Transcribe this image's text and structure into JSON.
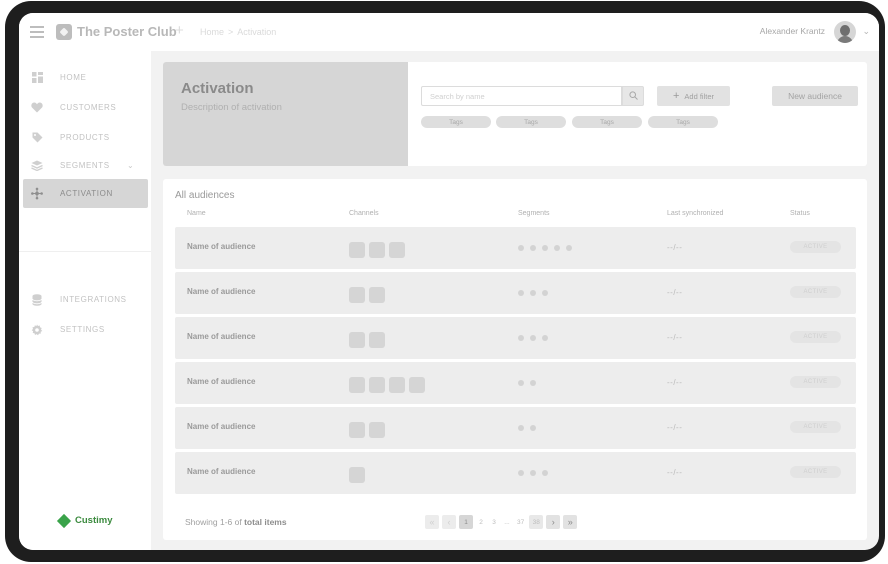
{
  "topbar": {
    "app_title": "The Poster Club",
    "breadcrumb": [
      "Home",
      "Activation"
    ],
    "user_name": "Alexander Krantz"
  },
  "sidebar": {
    "items": [
      {
        "label": "HOME",
        "icon": "grid-icon"
      },
      {
        "label": "CUSTOMERS",
        "icon": "heart-icon"
      },
      {
        "label": "PRODUCTS",
        "icon": "tag-icon"
      },
      {
        "label": "SEGMENTS",
        "icon": "layers-icon"
      },
      {
        "label": "ACTIVATION",
        "icon": "network-icon",
        "active": true
      }
    ],
    "bottom_items": [
      {
        "label": "INTEGRATIONS",
        "icon": "database-icon"
      },
      {
        "label": "SETTINGS",
        "icon": "gear-icon"
      }
    ],
    "brand": "Custimy"
  },
  "header": {
    "title": "Activation",
    "description": "Description of activation",
    "search_placeholder": "Search by name",
    "add_filter_label": "Add filter",
    "new_audience_label": "New audience",
    "tags": [
      "Tags",
      "Tags",
      "Tags",
      "Tags"
    ]
  },
  "table": {
    "title": "All audiences",
    "columns": [
      "Name",
      "Channels",
      "Segments",
      "Last synchronized",
      "Status"
    ],
    "rows": [
      {
        "name": "Name of audience",
        "channels": 3,
        "segments": 5,
        "last_sync": "--/--",
        "status": "ACTIVE"
      },
      {
        "name": "Name of audience",
        "channels": 2,
        "segments": 3,
        "last_sync": "--/--",
        "status": "ACTIVE"
      },
      {
        "name": "Name of audience",
        "channels": 2,
        "segments": 3,
        "last_sync": "--/--",
        "status": "ACTIVE"
      },
      {
        "name": "Name of audience",
        "channels": 4,
        "segments": 2,
        "last_sync": "--/--",
        "status": "ACTIVE"
      },
      {
        "name": "Name of audience",
        "channels": 2,
        "segments": 2,
        "last_sync": "--/--",
        "status": "ACTIVE"
      },
      {
        "name": "Name of audience",
        "channels": 1,
        "segments": 3,
        "last_sync": "--/--",
        "status": "ACTIVE"
      }
    ]
  },
  "footer": {
    "showing_prefix": "Showing 1-6 of",
    "showing_bold": "total items",
    "pages": [
      "1",
      "2",
      "3",
      "...",
      "37",
      "38"
    ],
    "current_page": "1"
  }
}
